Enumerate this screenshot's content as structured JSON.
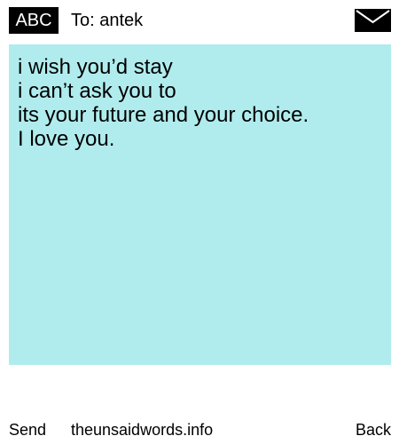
{
  "header": {
    "badge_label": "ABC",
    "to_label": "To: antek",
    "envelope_icon": "envelope-icon"
  },
  "message": {
    "lines": [
      "i wish you’d stay",
      "i can’t ask you to",
      "its your future and your choice.",
      "I love you."
    ],
    "background_color": "#b0ecee"
  },
  "footer": {
    "send_label": "Send",
    "site_label": "theunsaidwords.info",
    "back_label": "Back"
  }
}
